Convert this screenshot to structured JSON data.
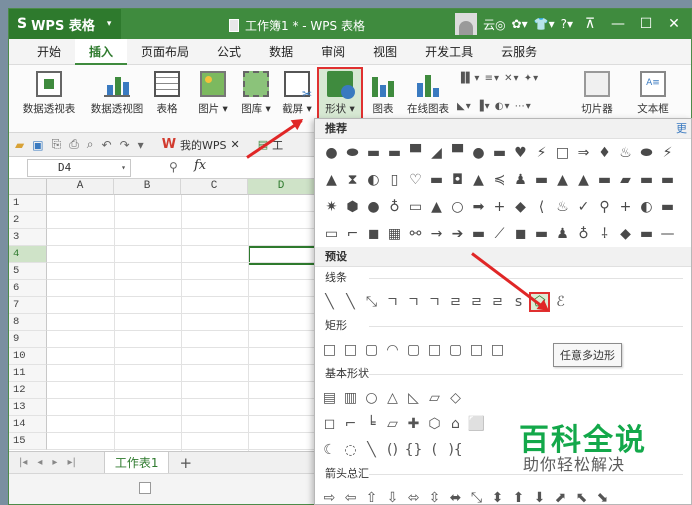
{
  "window": {
    "app_name": "WPS 表格",
    "doc_title": "工作簿1 * - WPS 表格",
    "status_text": "云◎"
  },
  "menu": {
    "tabs": [
      "开始",
      "插入",
      "页面布局",
      "公式",
      "数据",
      "审阅",
      "视图",
      "开发工具",
      "云服务"
    ],
    "active": "插入"
  },
  "ribbon": {
    "pivot_table": "数据透视表",
    "pivot_chart": "数据透视图",
    "table": "表格",
    "picture": "图片 ▾",
    "gallery": "图库 ▾",
    "screenshot": "截屏 ▾",
    "shape": "形状 ▾",
    "chart": "图表",
    "online_chart": "在线图表",
    "clipboard": "切片器",
    "textbox": "文本框"
  },
  "quickbar": {
    "doc_tab": "我的WPS",
    "doc_tab2": "工"
  },
  "formula": {
    "cell_ref": "D4",
    "fx_label": "fx"
  },
  "grid": {
    "columns": [
      "A",
      "B",
      "C",
      "D"
    ],
    "rows": [
      "1",
      "2",
      "3",
      "4",
      "5",
      "6",
      "7",
      "8",
      "9",
      "10",
      "11",
      "12",
      "13",
      "14",
      "15"
    ],
    "selected_col": "D",
    "selected_row": "4"
  },
  "sheets": {
    "names": [
      "工作表1"
    ],
    "add_label": "+"
  },
  "shape_panel": {
    "header": "推荐",
    "more": "更",
    "preset_header": "预设",
    "lines_header": "线条",
    "rect_header": "矩形",
    "basic_header": "基本形状",
    "arrow_header": "箭头总汇",
    "tooltip": "任意多边形",
    "rec_rows": [
      [
        "●",
        "⬬",
        "▬",
        "▬",
        "▀",
        "◢",
        "▀",
        "●",
        "▬",
        "♥",
        "⚡",
        "□",
        "⇒",
        "♦",
        "♨",
        "⬬",
        "⚡"
      ],
      [
        "▲",
        "⧗",
        "◐",
        "▯",
        "♡",
        "▬",
        "◘",
        "▲",
        "≼",
        "♟",
        "▬",
        "▲",
        "▲",
        "▬",
        "▰",
        "▬",
        "▬"
      ],
      [
        "✷",
        "⬢",
        "●",
        "♁",
        "▭",
        "▲",
        "○",
        "➡",
        "+",
        "◆",
        "⟨",
        "♨",
        "✓",
        "⚲",
        "+",
        "◐",
        "▬"
      ],
      [
        "▭",
        "⌐",
        "◼",
        "▦",
        "⚯",
        "→",
        "➔",
        "▬",
        "⟋",
        "◼",
        "▬",
        "♟",
        "♁",
        "⸸",
        "◆",
        "▬",
        "—"
      ]
    ],
    "line_items": [
      "╲",
      "╲",
      "⤡",
      "ㄱ",
      "ㄱ",
      "ㄱ",
      "ㄹ",
      "ㄹ",
      "ㄹ",
      "ꜱ",
      "⬠",
      "ℰ"
    ],
    "rect_items": [
      "□",
      "□",
      "▢",
      "◠",
      "▢",
      "□",
      "▢",
      "□",
      "□"
    ],
    "basic_items": [
      "▤",
      "▥",
      "○",
      "△",
      "◺",
      "▱",
      "◇"
    ],
    "basic_items2": [
      "◻",
      "⌐",
      "╘",
      "▱",
      "✚",
      "⬡",
      "⌂",
      "⬜"
    ],
    "basic_items3": [
      "☾",
      "◌",
      "╲",
      "()",
      "{}",
      "(",
      "){"
    ],
    "arrow_items": [
      "⇨",
      "⇦",
      "⇧",
      "⇩",
      "⬄",
      "⇳",
      "⬌",
      "⤡",
      "⬍",
      "⬆",
      "⬇",
      "⬈",
      "⬉",
      "⬊"
    ],
    "watermark_title": "百科全说",
    "watermark_sub": "助你轻松解决"
  },
  "colors": {
    "brand_green": "#3f8b3e",
    "highlight_red": "#e02626",
    "watermark_green": "#13a84a"
  }
}
